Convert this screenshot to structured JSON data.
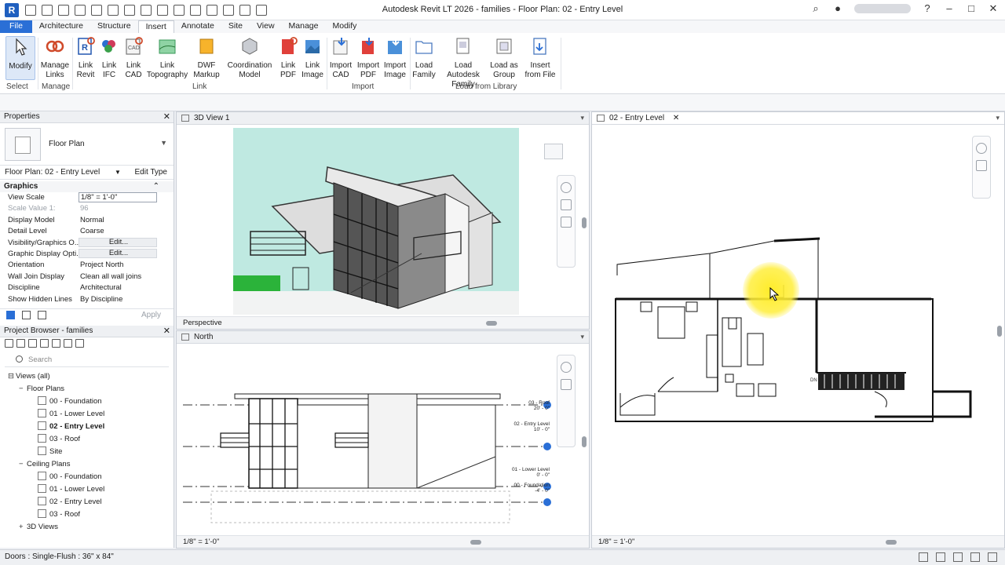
{
  "window": {
    "app_logo": "R",
    "title": "Autodesk Revit LT 2026 - families - Floor Plan: 02 - Entry Level"
  },
  "ribbon": {
    "tabs": [
      "File",
      "Architecture",
      "Structure",
      "Insert",
      "Annotate",
      "Site",
      "View",
      "Manage",
      "Modify"
    ],
    "active_tab": "Insert",
    "buttons": {
      "modify": "Modify",
      "manage_links": [
        "Manage",
        "Links"
      ],
      "link_revit": [
        "Link",
        "Revit"
      ],
      "link_ifc": [
        "Link",
        "IFC"
      ],
      "link_cad": [
        "Link",
        "CAD"
      ],
      "link_topography": [
        "Link",
        "Topography"
      ],
      "dwf_markup": [
        "DWF",
        "Markup"
      ],
      "coordination_model": [
        "Coordination",
        "Model"
      ],
      "link_pdf": [
        "Link",
        "PDF"
      ],
      "link_image": [
        "Link",
        "Image"
      ],
      "import_cad": [
        "Import",
        "CAD"
      ],
      "import_pdf": [
        "Import",
        "PDF"
      ],
      "import_image": [
        "Import",
        "Image"
      ],
      "load_family": [
        "Load",
        "Family"
      ],
      "load_autodesk_family": [
        "Load Autodesk",
        "Family"
      ],
      "load_as_group": [
        "Load as",
        "Group"
      ],
      "insert_from_file": [
        "Insert",
        "from File"
      ]
    },
    "panels": {
      "select": "Select",
      "manage": "Manage",
      "link": "Link",
      "import": "Import",
      "load_from_library": "Load from Library"
    }
  },
  "properties": {
    "title": "Properties",
    "type_name": "Floor Plan",
    "instance_selector": "Floor Plan: 02 - Entry Level",
    "edit_type": "Edit Type",
    "category": "Graphics",
    "rows": [
      {
        "k": "View Scale",
        "v": "1/8\" = 1'-0\"",
        "style": "box"
      },
      {
        "k": "Scale Value    1:",
        "v": "96",
        "style": "dim"
      },
      {
        "k": "Display Model",
        "v": "Normal",
        "style": ""
      },
      {
        "k": "Detail Level",
        "v": "Coarse",
        "style": ""
      },
      {
        "k": "Visibility/Graphics O...",
        "v": "Edit...",
        "style": "btn"
      },
      {
        "k": "Graphic Display Opti...",
        "v": "Edit...",
        "style": "btn"
      },
      {
        "k": "Orientation",
        "v": "Project North",
        "style": ""
      },
      {
        "k": "Wall Join Display",
        "v": "Clean all wall joins",
        "style": ""
      },
      {
        "k": "Discipline",
        "v": "Architectural",
        "style": ""
      },
      {
        "k": "Show Hidden Lines",
        "v": "By Discipline",
        "style": ""
      }
    ],
    "apply": "Apply"
  },
  "project_browser": {
    "title": "Project Browser - families",
    "search_placeholder": "Search",
    "tree": [
      {
        "label": "Views (all)",
        "level": 0,
        "twist": "⊟",
        "bold": false,
        "view": false
      },
      {
        "label": "Floor Plans",
        "level": 1,
        "twist": "−",
        "bold": false,
        "view": false
      },
      {
        "label": "00 - Foundation",
        "level": 2,
        "twist": "",
        "bold": false,
        "view": true
      },
      {
        "label": "01 - Lower Level",
        "level": 2,
        "twist": "",
        "bold": false,
        "view": true
      },
      {
        "label": "02 - Entry Level",
        "level": 2,
        "twist": "",
        "bold": true,
        "view": true
      },
      {
        "label": "03 - Roof",
        "level": 2,
        "twist": "",
        "bold": false,
        "view": true
      },
      {
        "label": "Site",
        "level": 2,
        "twist": "",
        "bold": false,
        "view": true
      },
      {
        "label": "Ceiling Plans",
        "level": 1,
        "twist": "−",
        "bold": false,
        "view": false
      },
      {
        "label": "00 - Foundation",
        "level": 2,
        "twist": "",
        "bold": false,
        "view": true
      },
      {
        "label": "01 - Lower Level",
        "level": 2,
        "twist": "",
        "bold": false,
        "view": true
      },
      {
        "label": "02 - Entry Level",
        "level": 2,
        "twist": "",
        "bold": false,
        "view": true
      },
      {
        "label": "03 - Roof",
        "level": 2,
        "twist": "",
        "bold": false,
        "view": true
      },
      {
        "label": "3D Views",
        "level": 1,
        "twist": "+",
        "bold": false,
        "view": false
      }
    ]
  },
  "views": {
    "view3d": {
      "tab": "3D View 1",
      "bar": "Perspective"
    },
    "north": {
      "tab": "North",
      "bar": "1/8\" = 1'-0\"",
      "levels": [
        {
          "name": "03 - Roof",
          "elev": "20' - 0\""
        },
        {
          "name": "02 - Entry Level",
          "elev": "10' - 0\""
        },
        {
          "name": "01 - Lower Level",
          "elev": "0' - 0\""
        },
        {
          "name": "00 - Foundation",
          "elev": "-4' - 0\""
        }
      ]
    },
    "plan": {
      "tab": "02 - Entry Level",
      "bar": "1/8\" = 1'-0\"",
      "dn_label": "DN"
    }
  },
  "status_bar": {
    "text": "Doors : Single-Flush : 36\" x 84\""
  },
  "colors": {
    "accent": "#2a6fd6",
    "cursor_highlight": "#ffe91f",
    "sky": "#bfe9e1",
    "grass": "#2bb33a"
  }
}
